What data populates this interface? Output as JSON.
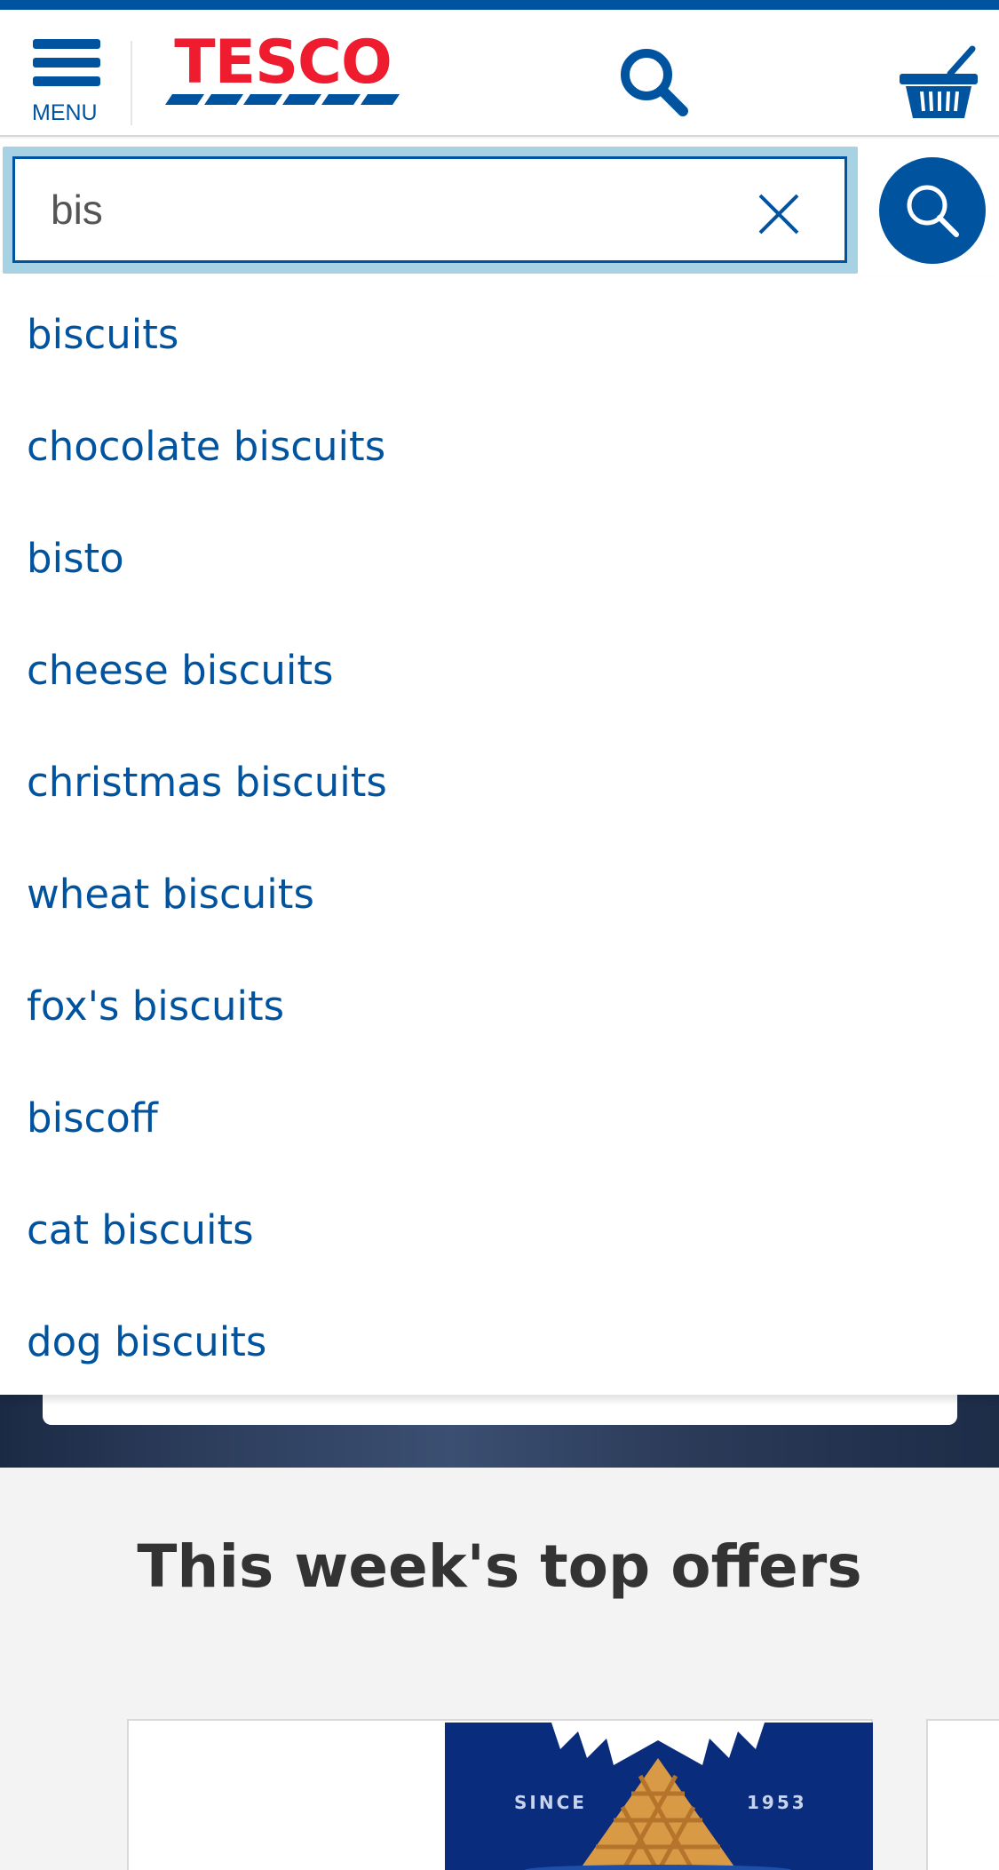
{
  "header": {
    "menu_label": "MENU",
    "logo_text": "TESCO"
  },
  "search": {
    "value": "bis",
    "placeholder": ""
  },
  "suggestions": [
    "biscuits",
    "chocolate biscuits",
    "bisto",
    "cheese biscuits",
    "christmas biscuits",
    "wheat biscuits",
    "fox's biscuits",
    "biscoff",
    "cat biscuits",
    "dog biscuits"
  ],
  "offers": {
    "title": "This week's top offers",
    "card_since_left": "SINCE",
    "card_since_right": "1953"
  },
  "colors": {
    "brand_blue": "#00539f",
    "brand_red": "#ee1c2e",
    "focus_outline": "#a7d2e4"
  },
  "icons": [
    "menu-icon",
    "search-icon",
    "basket-icon",
    "close-icon"
  ]
}
